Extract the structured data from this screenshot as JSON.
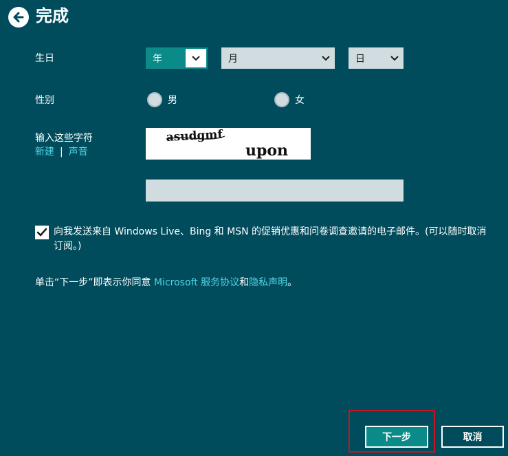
{
  "header": {
    "title": "完成",
    "back_icon": "arrow-left-circle-icon"
  },
  "birthday": {
    "label": "生日",
    "year": "年",
    "month": "月",
    "day": "日"
  },
  "gender": {
    "label": "性别",
    "male": "男",
    "female": "女"
  },
  "captcha": {
    "label": "输入这些字符",
    "new_link": "新建",
    "separator": "|",
    "audio_link": "声音",
    "text_line1": "asudgmf",
    "text_line2": "upon",
    "input_value": ""
  },
  "consent": {
    "checked": true,
    "text": "向我发送来自 Windows Live、Bing 和 MSN 的促销优惠和问卷调查邀请的电子邮件。(可以随时取消订阅。)"
  },
  "agreement": {
    "prefix": "单击“下一步”即表示你同意 ",
    "terms_link": "Microsoft 服务协议",
    "and": "和",
    "privacy_link": "隐私声明",
    "suffix": "。"
  },
  "buttons": {
    "next": "下一步",
    "cancel": "取消"
  },
  "colors": {
    "background": "#004c5c",
    "accent": "#0b8a8a",
    "link": "#4fd4e6",
    "highlight": "#c8141e"
  }
}
